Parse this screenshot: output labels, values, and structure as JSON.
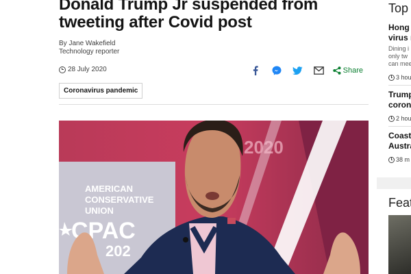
{
  "article": {
    "headline": "Donald Trump Jr suspended from tweeting after Covid post",
    "byline_author": "By Jane Wakefield",
    "byline_role": "Technology reporter",
    "date": "28 July 2020",
    "share_label": "Share",
    "tag": "Coronavirus pandemic",
    "hero_image": {
      "backdrop_text_1": "AMERICAN",
      "backdrop_text_2": "CONSERVATIVE",
      "backdrop_text_3": "UNION",
      "backdrop_logo": "CPAC",
      "backdrop_year": "202",
      "backdrop_year_top": "2020"
    }
  },
  "share_icons": [
    "facebook-icon",
    "messenger-icon",
    "twitter-icon",
    "email-icon",
    "share-icon"
  ],
  "colors": {
    "share_green": "#0b7f31",
    "facebook_blue": "#3b5998",
    "messenger_blue": "#1f86f5",
    "twitter_blue": "#1da1f2"
  },
  "sidebar": {
    "top_title": "Top",
    "stories": [
      {
        "title_1": "Hong K",
        "title_2": "virus r",
        "summary_1": "Dining i",
        "summary_2": "only tw",
        "summary_3": "can mee",
        "time": "3 hou"
      },
      {
        "title_1": "Trump",
        "title_2": "corona",
        "time": "2 hou"
      },
      {
        "title_1": "Coasta",
        "title_2": "Austra",
        "time": "38 m"
      }
    ],
    "features_title": "Feat"
  }
}
